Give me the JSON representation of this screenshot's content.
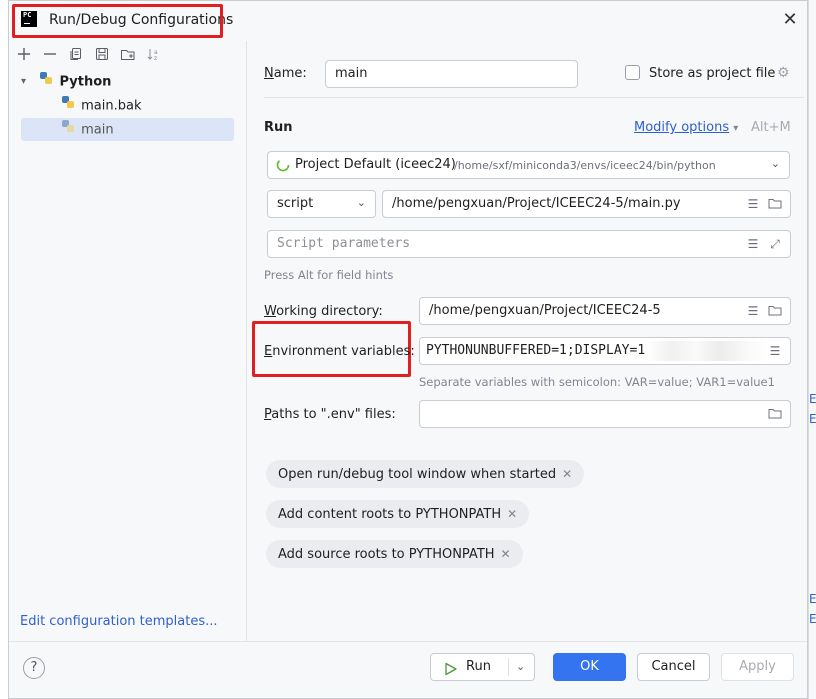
{
  "dialog": {
    "title": "Run/Debug Configurations",
    "app_icon_text": "PC",
    "close_icon": "close-icon"
  },
  "toolbar": {
    "icons": [
      "add-icon",
      "remove-icon",
      "copy-icon",
      "save-icon",
      "new-folder-icon",
      "sort-icon"
    ]
  },
  "tree": {
    "group": "Python",
    "items": [
      {
        "label": "main.bak",
        "selected": false
      },
      {
        "label": "main",
        "selected": true
      }
    ]
  },
  "edit_templates_link": "Edit configuration templates...",
  "form": {
    "name_label_prefix": "N",
    "name_label_rest": "ame:",
    "name_value": "main",
    "store_as_project_file": "Store as project file",
    "run_heading": "Run",
    "modify_options": "Modify options",
    "modify_shortcut": "Alt+M",
    "interpreter_name": "Project Default (iceec24)",
    "interpreter_path": "/home/sxf/miniconda3/envs/iceec24/bin/python",
    "script_type": "script",
    "script_path": "/home/pengxuan/Project/ICEEC24-5/main.py",
    "script_params_placeholder": "Script parameters",
    "field_hints": "Press Alt for field hints",
    "working_dir_label_prefix": "W",
    "working_dir_label_rest": "orking directory:",
    "working_dir_value": "/home/pengxuan/Project/ICEEC24-5",
    "env_label_prefix": "E",
    "env_label_rest": "nvironment variables:",
    "env_value": "PYTHONUNBUFFERED=1;DISPLAY=1",
    "env_hint": "Separate variables with semicolon: VAR=value; VAR1=value1",
    "env_files_label_prefix": "P",
    "env_files_label_rest": "aths to \".env\" files:",
    "chips": [
      "Open run/debug tool window when started",
      "Add content roots to PYTHONPATH",
      "Add source roots to PYTHONPATH"
    ]
  },
  "buttons": {
    "help": "?",
    "run": "Run",
    "ok": "OK",
    "cancel": "Cancel",
    "apply": "Apply"
  },
  "colors": {
    "accent": "#3574f0",
    "link": "#2f5fcf",
    "highlight_box": "#e02020",
    "selection": "#dbe5f7"
  }
}
